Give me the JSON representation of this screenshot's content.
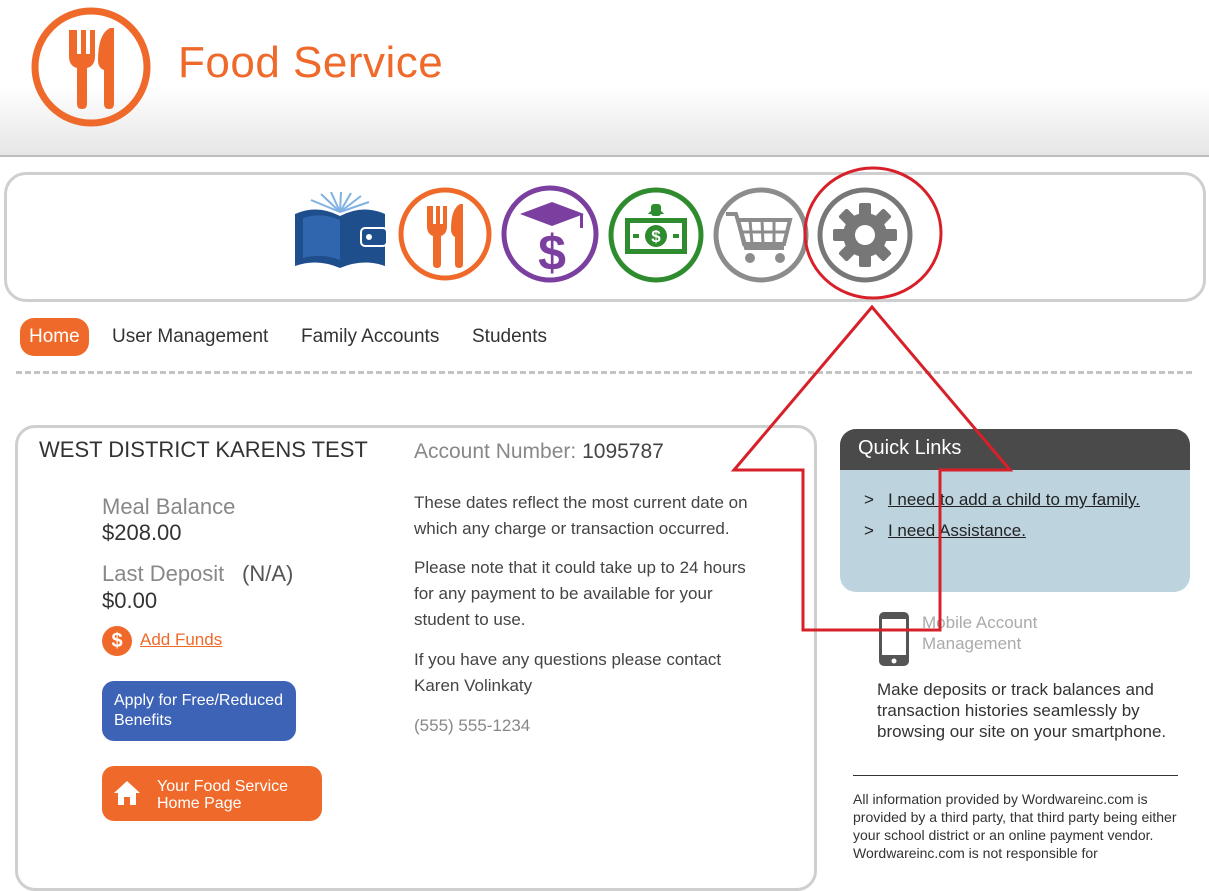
{
  "header": {
    "title": "Food Service",
    "logo_icon": "fork-knife-icon"
  },
  "app_icons": [
    "wallet-book-icon",
    "fork-knife-icon",
    "graduation-dollar-icon",
    "cash-bill-icon",
    "shopping-cart-icon",
    "gear-icon"
  ],
  "nav": {
    "items": [
      "Home",
      "User Management",
      "Family Accounts",
      "Students"
    ],
    "active": "Home"
  },
  "account": {
    "district_name": "WEST DISTRICT KARENS TEST",
    "meal_balance_label": "Meal Balance",
    "meal_balance_value": "$208.00",
    "last_deposit_label": "Last Deposit",
    "last_deposit_note": "(N/A)",
    "last_deposit_value": "$0.00",
    "add_funds_label": "Add Funds",
    "add_funds_icon_glyph": "$",
    "free_reduced_button": "Apply for Free/Reduced Benefits",
    "home_page_button": "Your Food Service Home Page",
    "account_number_label": "Account Number:",
    "account_number_value": "1095787",
    "para1": "These dates reflect the most current date on which any charge or transaction occurred.",
    "para2": "Please note that it could take up to 24 hours for any payment to be available for your student to use.",
    "para3": "If you have any questions please contact Karen Volinkaty",
    "phone": "(555) 555-1234"
  },
  "quick_links": {
    "title": "Quick Links",
    "items": [
      {
        "chevron": ">",
        "label": "I need to add a child to my family."
      },
      {
        "chevron": ">",
        "label": "I need Assistance."
      }
    ]
  },
  "mobile": {
    "title": "Mobile Account Management",
    "text": "Make deposits or track balances and transaction histories seamlessly by browsing our site on your smartphone."
  },
  "disclaimer": "All information provided by Wordwareinc.com is provided by a third party, that third party being either your school district or an online payment vendor. Wordwareinc.com is not responsible for",
  "colors": {
    "brand_orange": "#ef6a2a",
    "blue_button": "#3d63b6",
    "annotation_red": "#d8202a",
    "purple": "#7b3fa0",
    "green": "#2e8b2e"
  }
}
